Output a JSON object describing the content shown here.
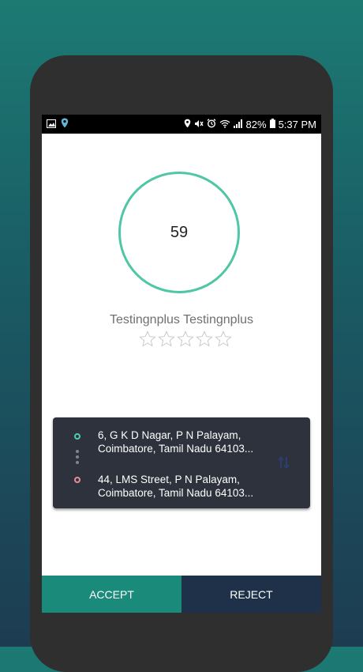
{
  "status_bar": {
    "battery": "82%",
    "time": "5:37 PM"
  },
  "timer": {
    "value": "59"
  },
  "driver": {
    "name": "Testingnplus Testingnplus",
    "rating": 0,
    "rating_max": 5
  },
  "route": {
    "pickup": "6, G K D Nagar, P N Palayam, Coimbatore, Tamil Nadu 64103...",
    "drop": "44, LMS Street, P N Palayam, Coimbatore, Tamil Nadu 64103..."
  },
  "actions": {
    "accept_label": "ACCEPT",
    "reject_label": "REJECT"
  },
  "colors": {
    "accent": "#4fc6a5",
    "accept_bg": "#1a8a7a",
    "reject_bg": "#1f3149",
    "card_bg": "#2d323c"
  }
}
